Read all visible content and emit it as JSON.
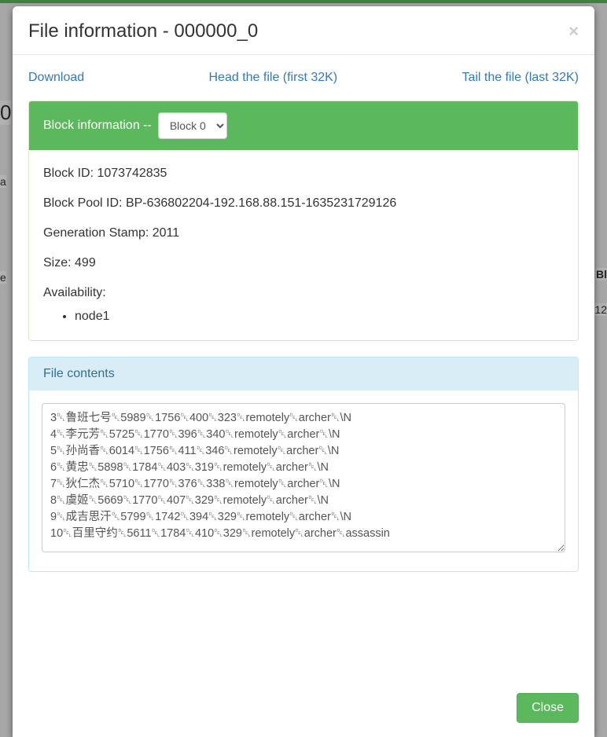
{
  "modal": {
    "title": "File information - 000000_0",
    "links": {
      "download": "Download",
      "head": "Head the file (first 32K)",
      "tail": "Tail the file (last 32K)"
    },
    "close_button": "Close"
  },
  "block_info": {
    "heading": "Block information --",
    "selected": "Block 0",
    "options": [
      "Block 0"
    ],
    "block_id_label": "Block ID:",
    "block_id": "1073742835",
    "pool_id_label": "Block Pool ID:",
    "pool_id": "BP-636802204-192.168.88.151-1635231729126",
    "gen_stamp_label": "Generation Stamp:",
    "gen_stamp": "2011",
    "size_label": "Size:",
    "size": "499",
    "availability_label": "Availability:",
    "availability": [
      "node1"
    ]
  },
  "file_contents": {
    "heading": "File contents",
    "text": "3␡鲁班七号␡5989␡1756␡400␡323␡remotely␡archer␡\\N\n4␡李元芳␡5725␡1770␡396␡340␡remotely␡archer␡\\N\n5␡孙尚香␡6014␡1756␡411␡346␡remotely␡archer␡\\N\n6␡黄忠␡5898␡1784␡403␡319␡remotely␡archer␡\\N\n7␡狄仁杰␡5710␡1770␡376␡338␡remotely␡archer␡\\N\n8␡虞姬␡5669␡1770␡407␡329␡remotely␡archer␡\\N\n9␡成吉思汗␡5799␡1742␡394␡329␡remotely␡archer␡\\N\n10␡百里守约␡5611␡1784␡410␡329␡remotely␡archer␡assassin"
  },
  "background": {
    "left_hint_1": "0",
    "left_hint_2": "a",
    "left_hint_3": "e",
    "right_hint_1": "Bl",
    "right_hint_2": "12"
  }
}
